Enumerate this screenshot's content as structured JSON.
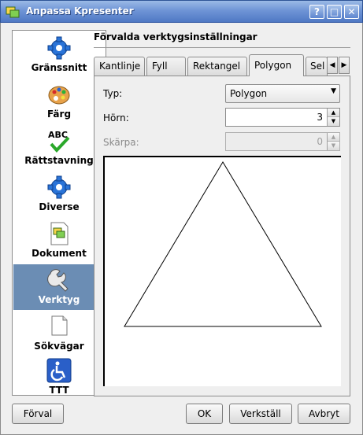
{
  "window": {
    "title": "Anpassa Kpresenter",
    "buttons": {
      "help": "?",
      "maximize": "□",
      "close": "✕"
    }
  },
  "sidebar": {
    "items": [
      {
        "label": "Gränssnitt",
        "icon": "gear-icon"
      },
      {
        "label": "Färg",
        "icon": "palette-icon"
      },
      {
        "label": "Rättstavning",
        "icon": "spellcheck-icon"
      },
      {
        "label": "Diverse",
        "icon": "gear-icon"
      },
      {
        "label": "Dokument",
        "icon": "document-icon"
      },
      {
        "label": "Verktyg",
        "icon": "wrench-icon",
        "selected": true
      },
      {
        "label": "Sökvägar",
        "icon": "path-document-icon"
      },
      {
        "label": "TTT",
        "icon": "accessibility-icon"
      }
    ]
  },
  "page": {
    "title": "Förvalda verktygsinställningar",
    "tabs": [
      "Kantlinje",
      "Fyll",
      "Rektangel",
      "Polygon",
      "Sel"
    ],
    "active_tab": "Polygon",
    "form": {
      "type_label": "Typ:",
      "type_value": "Polygon",
      "corners_label": "Hörn:",
      "corners_value": "3",
      "sharpness_label": "Skärpa:",
      "sharpness_value": "0"
    },
    "preview": {
      "shape": "triangle",
      "corners": 3
    }
  },
  "buttons": {
    "defaults": "Förval",
    "ok": "OK",
    "apply": "Verkställ",
    "cancel": "Avbryt"
  },
  "colors": {
    "title_bar": "#6f95d6",
    "selection": "#6b8db4",
    "gear_blue": "#2a74d8"
  }
}
